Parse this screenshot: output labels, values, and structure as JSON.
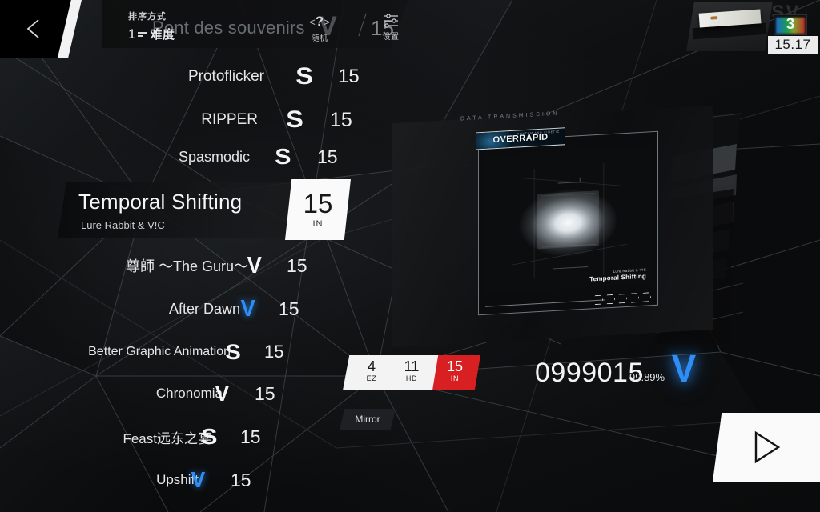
{
  "header": {
    "back_icon": "back-arrow-icon",
    "sort_label": "排序方式",
    "sort_number": "1",
    "sort_value": "难度",
    "ghost_song_title": "Pont des souvenirs",
    "ghost_rank": "V",
    "ghost_separator": "/",
    "ghost_level": "15",
    "random_icon": "question-mark-icon",
    "random_label": "随机",
    "settings_icon": "sliders-icon",
    "settings_label": "设置"
  },
  "top_right": {
    "thumbnail_name": "profile-thumbnail",
    "ghost_text": "ASV",
    "combo_badge": "3",
    "rating": "15.17"
  },
  "song_list": {
    "items": [
      {
        "title": "Protoflicker",
        "grade": "S",
        "grade_color": "white",
        "level": "15",
        "selected": false
      },
      {
        "title": "RIPPER",
        "grade": "S",
        "grade_color": "white",
        "level": "15",
        "selected": false
      },
      {
        "title": "Spasmodic",
        "grade": "S",
        "grade_color": "white",
        "level": "15",
        "selected": false
      },
      {
        "title": "Temporal Shifting",
        "grade": "",
        "grade_color": "white",
        "level": "15",
        "selected": true,
        "artist": "Lure Rabbit & V!C",
        "badge_type": "IN"
      },
      {
        "title": "尊師 ～The Guru～",
        "grade": "V",
        "grade_color": "white",
        "level": "15",
        "selected": false
      },
      {
        "title": "After Dawn",
        "grade": "V",
        "grade_color": "blue",
        "level": "15",
        "selected": false
      },
      {
        "title": "Better Graphic Animation",
        "grade": "S",
        "grade_color": "white",
        "level": "15",
        "selected": false
      },
      {
        "title": "Chronomia",
        "grade": "V",
        "grade_color": "white",
        "level": "15",
        "selected": false
      },
      {
        "title": "Feast远东之宴",
        "grade": "S",
        "grade_color": "white",
        "level": "15",
        "selected": false
      },
      {
        "title": "Upshift",
        "grade": "V",
        "grade_color": "blue",
        "level": "15",
        "selected": false
      }
    ]
  },
  "selected": {
    "title": "Temporal Shifting",
    "artist": "Lure Rabbit & V!C",
    "badge_level": "15",
    "badge_type": "IN"
  },
  "jacket": {
    "brand": "OVERRAPID",
    "brand_sub": "RHYTHM AND KINETIC",
    "data_transmission": "DATA TRANSMISSION",
    "art_artist": "Lure Rabbit & V!C",
    "art_title": "Temporal Shifting"
  },
  "difficulty": {
    "options": [
      {
        "level": "4",
        "name": "EZ",
        "selected": false
      },
      {
        "level": "11",
        "name": "HD",
        "selected": false
      },
      {
        "level": "15",
        "name": "IN",
        "selected": true
      }
    ],
    "selected_color": "#d81f21"
  },
  "modifier": {
    "label": "Mirror"
  },
  "score": {
    "value": "0999015",
    "accuracy": "99.89%",
    "rank": "V",
    "rank_color": "#2f8ef5"
  },
  "play_button": {
    "icon": "play-triangle-icon"
  }
}
